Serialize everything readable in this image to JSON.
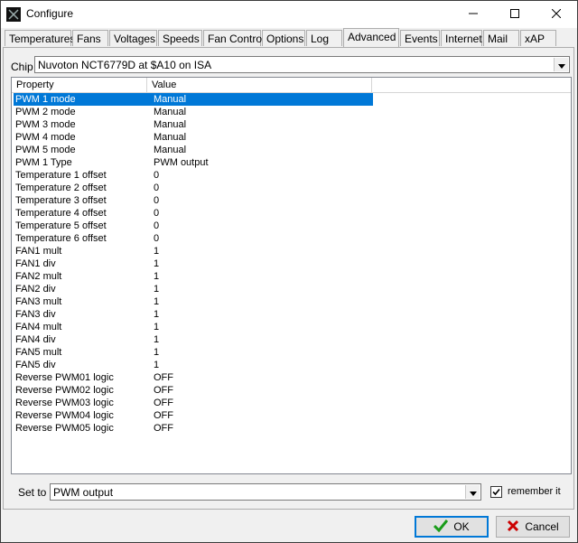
{
  "window": {
    "title": "Configure",
    "icon": "app-icon",
    "controls": {
      "minimize": "minimize-icon",
      "maximize": "maximize-icon",
      "close": "close-icon"
    }
  },
  "tabs": [
    {
      "label": "Temperatures"
    },
    {
      "label": "Fans"
    },
    {
      "label": "Voltages"
    },
    {
      "label": "Speeds"
    },
    {
      "label": "Fan Control"
    },
    {
      "label": "Options"
    },
    {
      "label": "Log"
    },
    {
      "label": "Advanced",
      "active": true
    },
    {
      "label": "Events"
    },
    {
      "label": "Internet"
    },
    {
      "label": "Mail"
    },
    {
      "label": "xAP"
    }
  ],
  "chip": {
    "label": "Chip",
    "value": "Nuvoton NCT6779D at $A10 on ISA"
  },
  "list": {
    "columns": [
      "Property",
      "Value"
    ],
    "rows": [
      [
        "PWM 1 mode",
        "Manual"
      ],
      [
        "PWM 2 mode",
        "Manual"
      ],
      [
        "PWM 3 mode",
        "Manual"
      ],
      [
        "PWM 4 mode",
        "Manual"
      ],
      [
        "PWM 5 mode",
        "Manual"
      ],
      [
        "PWM 1 Type",
        "PWM output"
      ],
      [
        "Temperature 1 offset",
        "0"
      ],
      [
        "Temperature 2 offset",
        "0"
      ],
      [
        "Temperature 3 offset",
        "0"
      ],
      [
        "Temperature 4 offset",
        "0"
      ],
      [
        "Temperature 5 offset",
        "0"
      ],
      [
        "Temperature 6 offset",
        "0"
      ],
      [
        "FAN1 mult",
        "1"
      ],
      [
        "FAN1 div",
        "1"
      ],
      [
        "FAN2 mult",
        "1"
      ],
      [
        "FAN2 div",
        "1"
      ],
      [
        "FAN3 mult",
        "1"
      ],
      [
        "FAN3 div",
        "1"
      ],
      [
        "FAN4 mult",
        "1"
      ],
      [
        "FAN4 div",
        "1"
      ],
      [
        "FAN5 mult",
        "1"
      ],
      [
        "FAN5 div",
        "1"
      ],
      [
        "Reverse PWM01 logic",
        "OFF"
      ],
      [
        "Reverse PWM02 logic",
        "OFF"
      ],
      [
        "Reverse PWM03 logic",
        "OFF"
      ],
      [
        "Reverse PWM04 logic",
        "OFF"
      ],
      [
        "Reverse PWM05 logic",
        "OFF"
      ]
    ],
    "selected_row": 0
  },
  "setto": {
    "label": "Set to",
    "value": "PWM output",
    "remember_label": "remember it",
    "remember_checked": true
  },
  "buttons": {
    "ok": "OK",
    "cancel": "Cancel"
  },
  "colors": {
    "selection": "#0078d7",
    "ok_check": "#1a9c1a",
    "cancel_x": "#cc0000"
  }
}
